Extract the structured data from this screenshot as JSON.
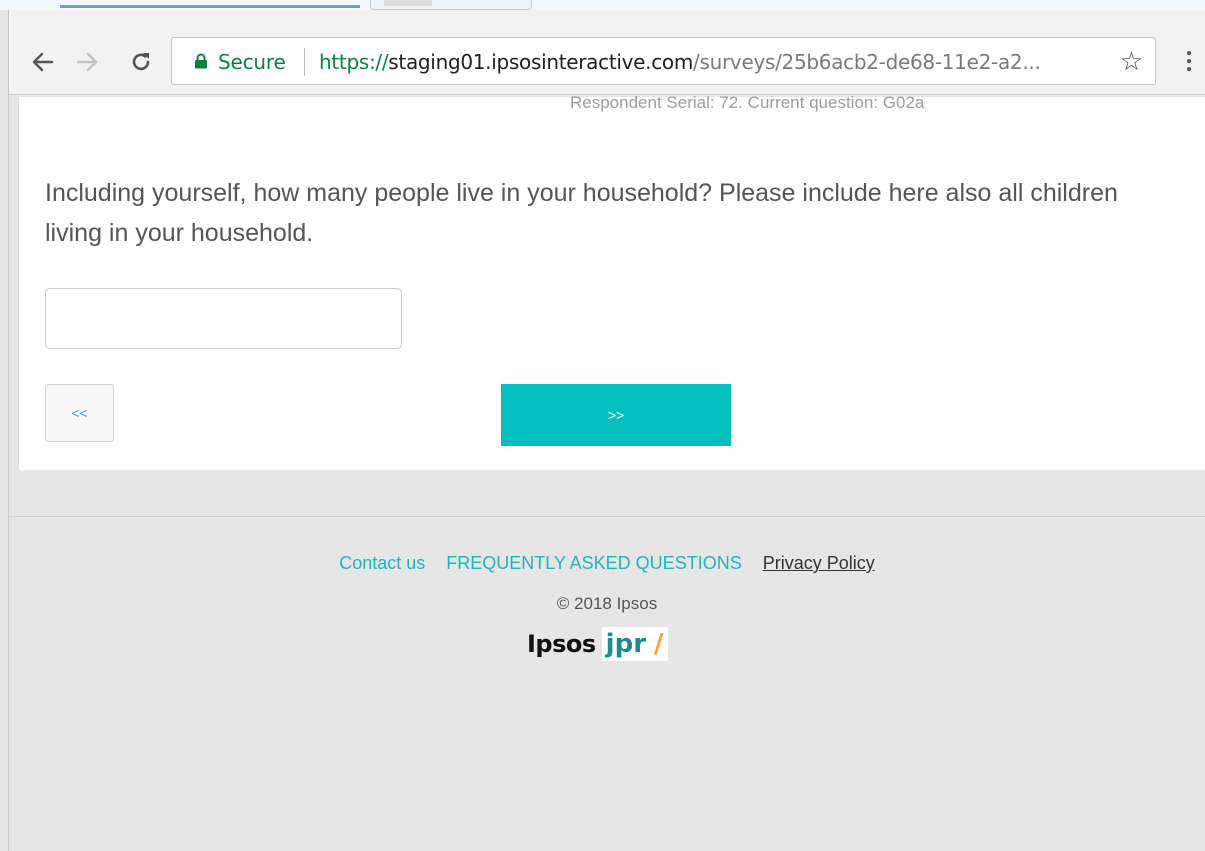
{
  "browser": {
    "security_label": "Secure",
    "url": {
      "scheme": "https://",
      "host": "staging01.ipsosinteractive.com",
      "path": "/surveys/25b6acb2-de68-11e2-a2..."
    },
    "icons": {
      "back": "arrow-left-icon",
      "forward": "arrow-right-icon",
      "reload": "reload-icon",
      "lock": "lock-icon",
      "bookmark": "star-icon",
      "menu": "vertical-dots-icon"
    },
    "colors": {
      "secure_green": "#0b8043"
    }
  },
  "survey": {
    "serial_text": "Respondent Serial: 72. Current question: G02a",
    "question": "Including yourself, how many people live in your household? Please include here also all children living in your household.",
    "answer": {
      "value": "",
      "placeholder": ""
    },
    "prev_label": "<<",
    "next_label": ">>",
    "colors": {
      "accent": "#00bfbd",
      "link": "#21b3bd"
    }
  },
  "footer": {
    "links": [
      {
        "label": "Contact us"
      },
      {
        "label": "FREQUENTLY ASKED QUESTIONS"
      },
      {
        "label": "Privacy Policy"
      }
    ],
    "copyright": "© 2018 Ipsos",
    "logo": {
      "word": "Ipsos",
      "sub": "jpr",
      "mark": "/"
    }
  }
}
